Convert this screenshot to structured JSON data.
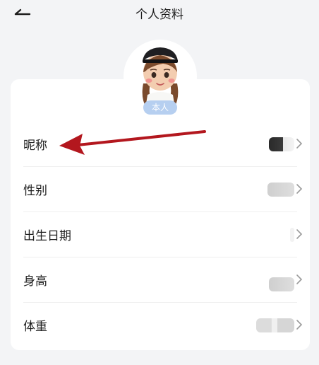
{
  "header": {
    "title": "个人资料",
    "back_icon": "arrow-left-icon"
  },
  "profile": {
    "badge": "本人"
  },
  "fields": [
    {
      "label": "昵称"
    },
    {
      "label": "性别"
    },
    {
      "label": "出生日期"
    },
    {
      "label": "身高"
    },
    {
      "label": "体重"
    }
  ],
  "colors": {
    "accent_badge": "#b6cff0",
    "annotation_arrow": "#b3171e",
    "page_bg": "#f3f4f6"
  }
}
